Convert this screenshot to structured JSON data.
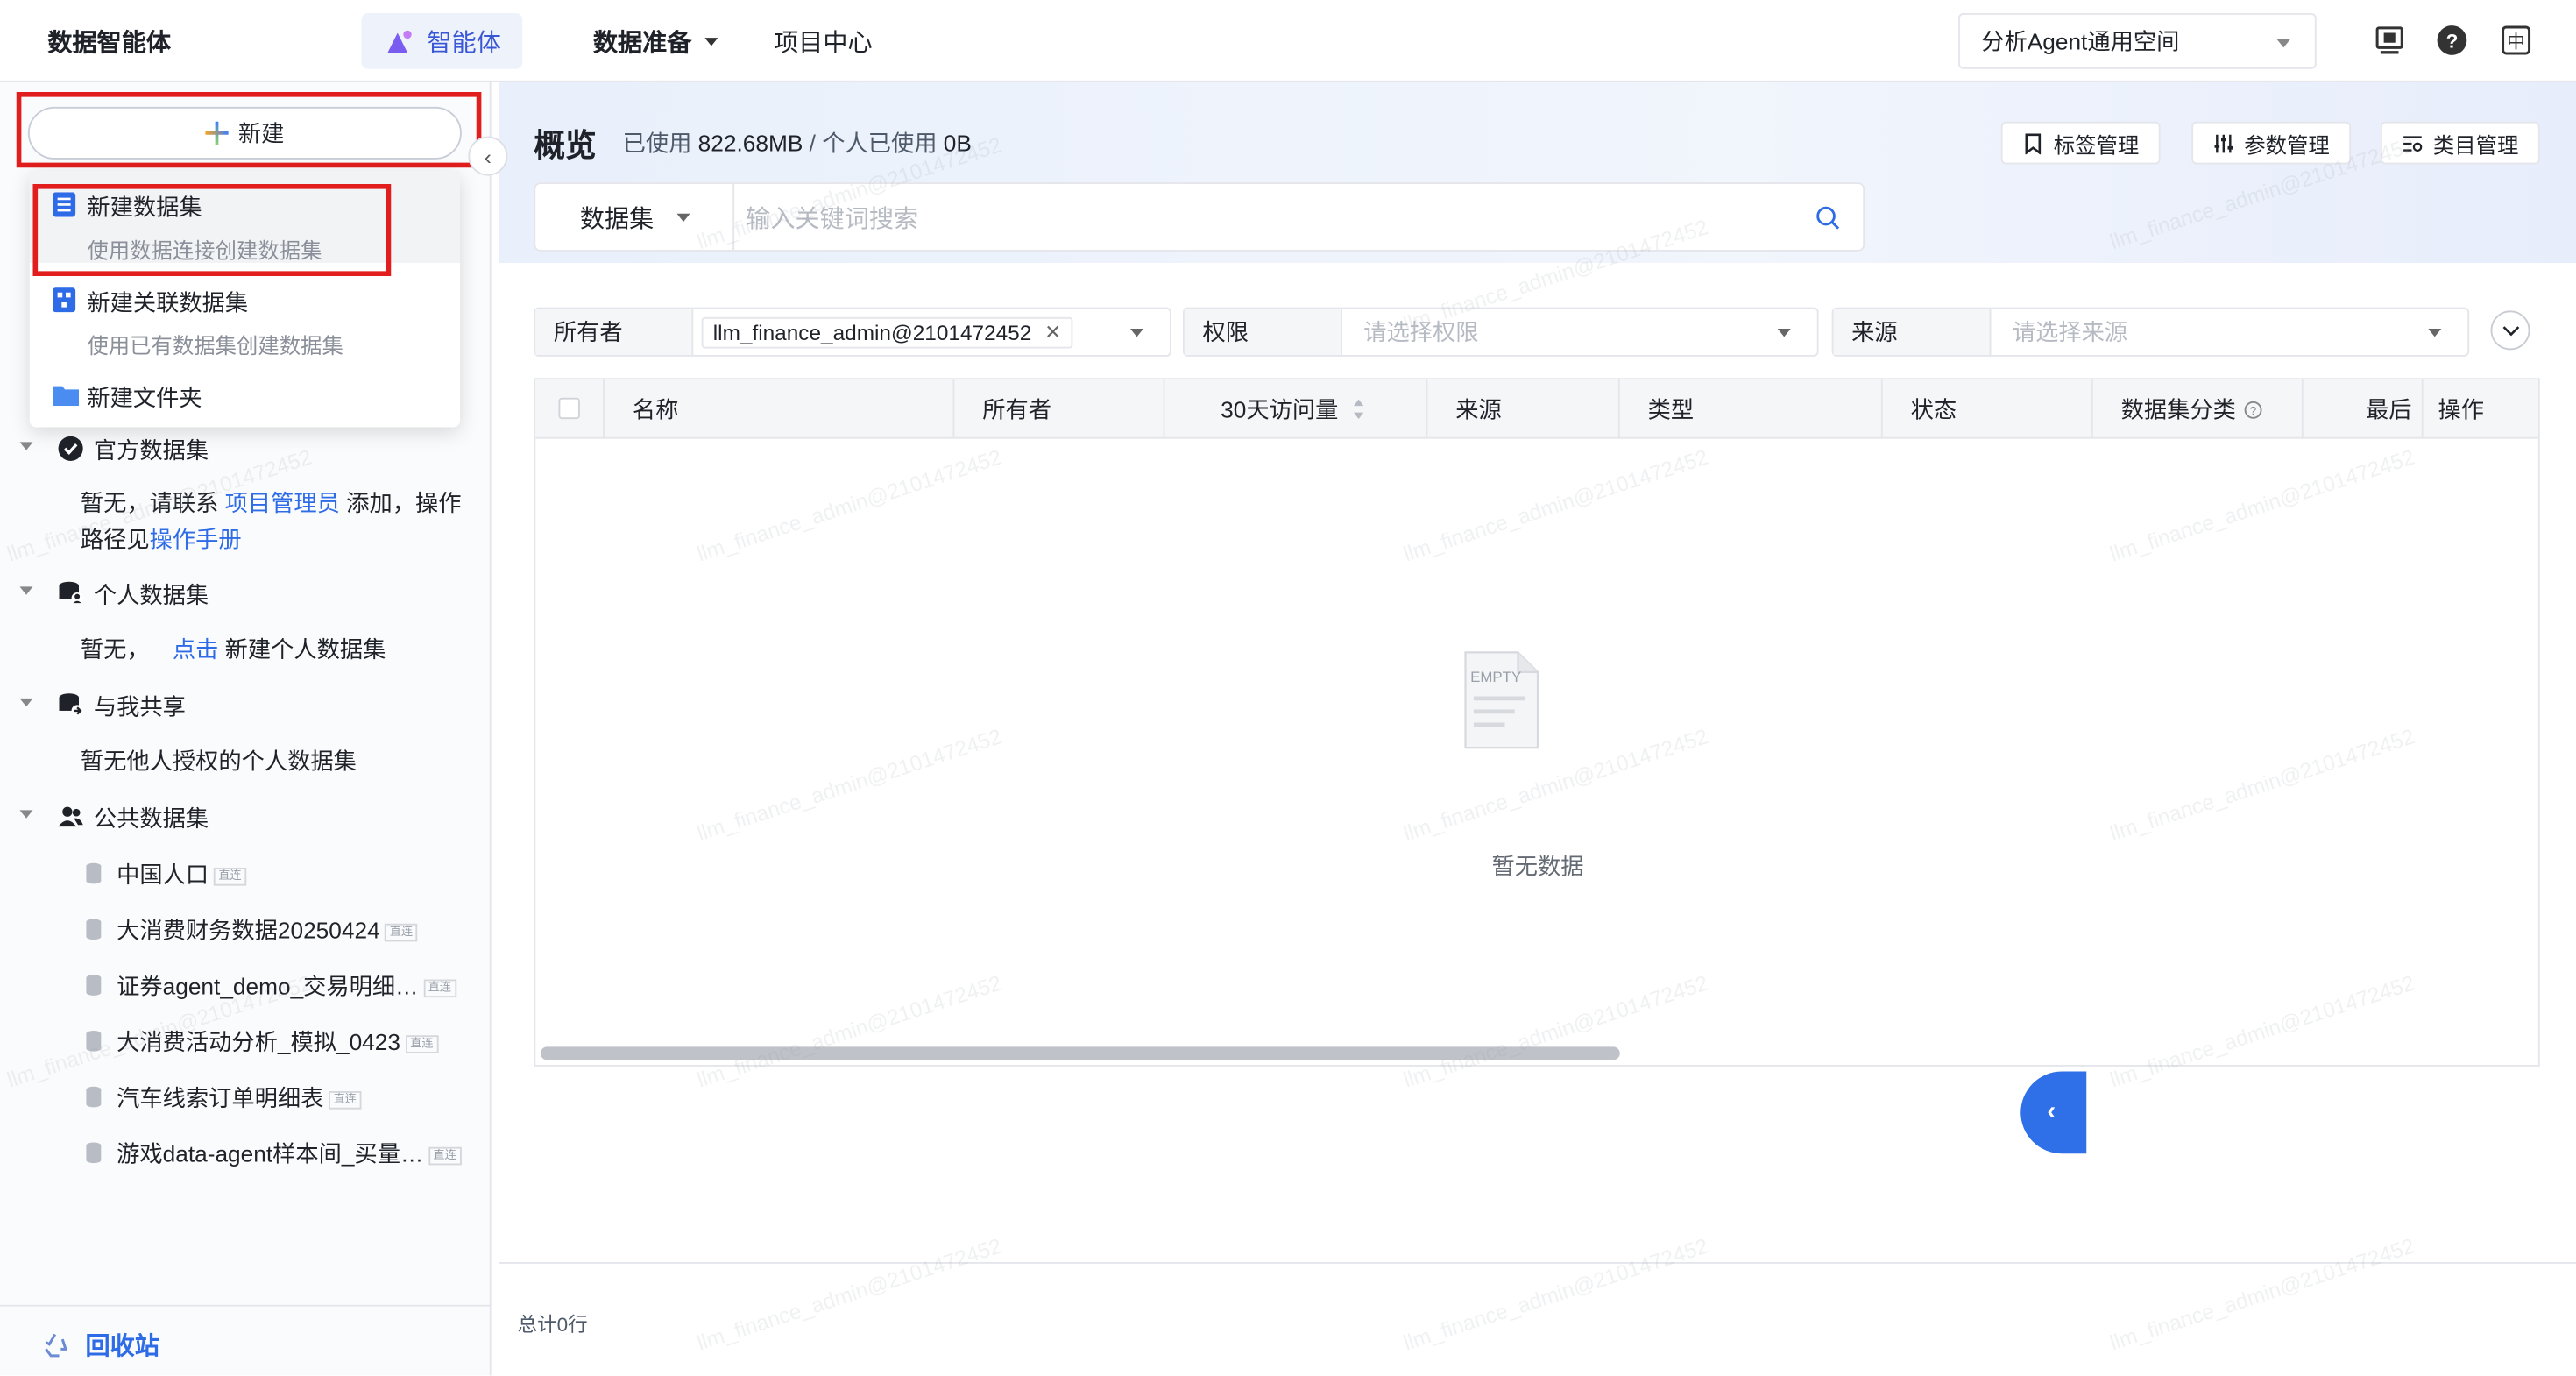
{
  "topbar": {
    "brand": "数据智能体",
    "nav_agent": "智能体",
    "nav_data": "数据准备",
    "nav_project": "项目中心",
    "space": "分析Agent通用空间",
    "icons": [
      "monitor-icon",
      "help-icon",
      "language-icon"
    ]
  },
  "sidebar": {
    "new_button": "新建",
    "dropdown": {
      "items": [
        {
          "title": "新建数据集",
          "subtitle": "使用数据连接创建数据集"
        },
        {
          "title": "新建关联数据集",
          "subtitle": "使用已有数据集创建数据集"
        }
      ],
      "folder": "新建文件夹"
    },
    "official": {
      "title": "官方数据集",
      "text_pre": "暂无，请联系 ",
      "link1": "项目管理员",
      "text_mid": " 添加，操作路径见",
      "link2": "操作手册"
    },
    "personal": {
      "title": "个人数据集",
      "text_pre": "暂无，",
      "link": "点击",
      "text_post": " 新建个人数据集"
    },
    "shared": {
      "title": "与我共享",
      "text": "暂无他人授权的个人数据集"
    },
    "public": {
      "title": "公共数据集",
      "items": [
        {
          "name": "中国人口",
          "tag": "直连"
        },
        {
          "name": "大消费财务数据20250424",
          "tag": "直连"
        },
        {
          "name": "证券agent_demo_交易明细…",
          "tag": "直连"
        },
        {
          "name": "大消费活动分析_模拟_0423",
          "tag": "直连"
        },
        {
          "name": "汽车线索订单明细表",
          "tag": "直连"
        },
        {
          "name": "游戏data-agent样本间_买量…",
          "tag": "直连"
        }
      ]
    },
    "recycle": "回收站"
  },
  "main": {
    "title": "概览",
    "usage_label1": "已使用 ",
    "usage_value1": "822.68MB",
    "usage_sep": " / 个人已使用 ",
    "usage_value2": "0B",
    "buttons": {
      "tag": "标签管理",
      "param": "参数管理",
      "category": "类目管理"
    },
    "search": {
      "type": "数据集",
      "placeholder": "输入关键词搜索"
    },
    "filters": {
      "owner_label": "所有者",
      "owner_value": "llm_finance_admin@2101472452",
      "perm_label": "权限",
      "perm_placeholder": "请选择权限",
      "source_label": "来源",
      "source_placeholder": "请选择来源"
    },
    "columns": [
      "名称",
      "所有者",
      "30天访问量",
      "来源",
      "类型",
      "状态",
      "数据集分类",
      "最后",
      "操作"
    ],
    "empty_icon_text": "EMPTY",
    "empty_text": "暂无数据",
    "total": "总计0行",
    "watermark": "llm_finance_admin@2101472452"
  },
  "colors": {
    "accent": "#2e6be6",
    "highlight_box": "#e11d1d",
    "float_button": "#2f6fe8"
  }
}
